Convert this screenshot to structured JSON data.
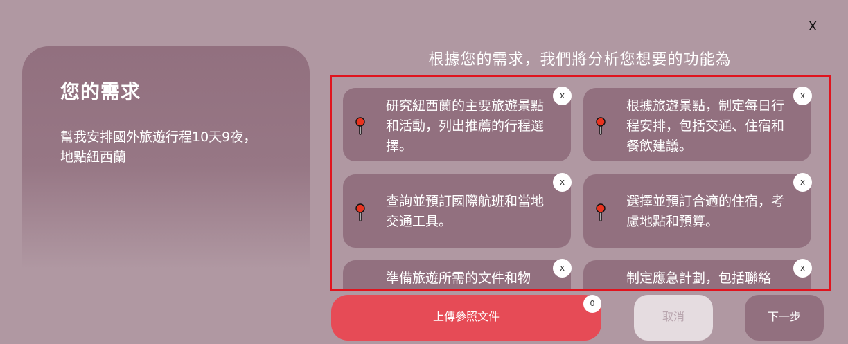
{
  "dialog": {
    "close_label": "X"
  },
  "requirement": {
    "title": "您的需求",
    "text": "幫我安排國外旅遊行程10天9夜，地點紐西蘭"
  },
  "analysis": {
    "heading": "根據您的需求，我們將分析您想要的功能為",
    "card_icon": "map-pin-icon",
    "card_close_label": "x",
    "cards": [
      {
        "text": "研究紐西蘭的主要旅遊景點和活動，列出推薦的行程選擇。"
      },
      {
        "text": "根據旅遊景點，制定每日行程安排，包括交通、住宿和餐飲建議。"
      },
      {
        "text": "查詢並預訂國際航班和當地交通工具。"
      },
      {
        "text": "選擇並預訂合適的住宿，考慮地點和預算。"
      },
      {
        "text": "準備旅遊所需的文件和物"
      },
      {
        "text": "制定應急計劃，包括聯絡"
      }
    ]
  },
  "actions": {
    "upload_label": "上傳參照文件",
    "upload_count": "0",
    "cancel_label": "取消",
    "next_label": "下一步"
  },
  "colors": {
    "background": "#b098a2",
    "card": "#92707f",
    "upload_button": "#e64b56",
    "highlight_border": "#e0141e",
    "pin_head": "#e8331f"
  }
}
